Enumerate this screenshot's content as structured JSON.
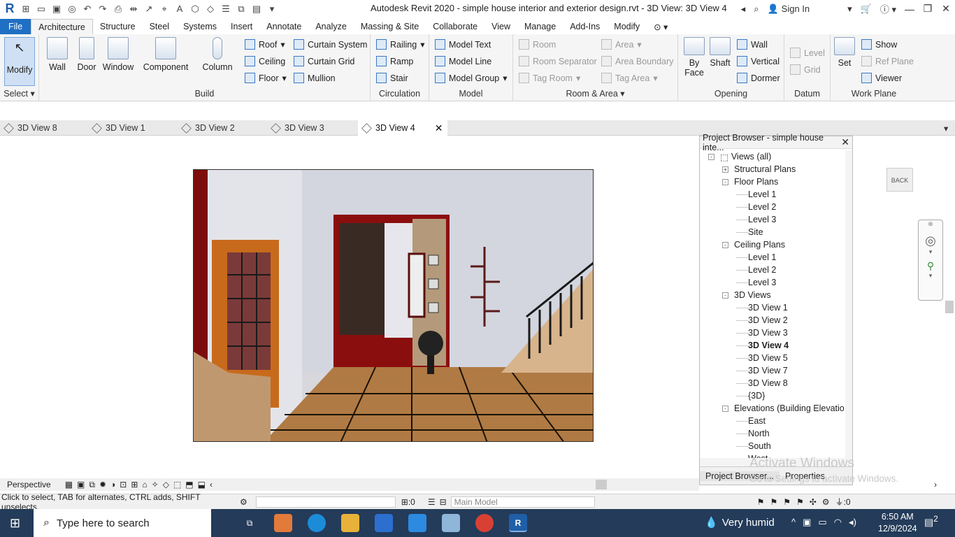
{
  "app": {
    "title": "Autodesk Revit 2020 - simple house interior and exterior design.rvt - 3D View: 3D View 4",
    "sign_in": "Sign In"
  },
  "ribbon_tabs": [
    "File",
    "Architecture",
    "Structure",
    "Steel",
    "Systems",
    "Insert",
    "Annotate",
    "Analyze",
    "Massing & Site",
    "Collaborate",
    "View",
    "Manage",
    "Add-Ins",
    "Modify"
  ],
  "ribbon": {
    "select": {
      "modify": "Modify",
      "label": "Select"
    },
    "build": {
      "wall": "Wall",
      "door": "Door",
      "window": "Window",
      "component": "Component",
      "column": "Column",
      "roof": "Roof",
      "ceiling": "Ceiling",
      "floor": "Floor",
      "curtain_system": "Curtain System",
      "curtain_grid": "Curtain Grid",
      "mullion": "Mullion",
      "label": "Build"
    },
    "circulation": {
      "railing": "Railing",
      "ramp": "Ramp",
      "stair": "Stair",
      "label": "Circulation"
    },
    "model": {
      "model_text": "Model Text",
      "model_line": "Model Line",
      "model_group": "Model Group",
      "label": "Model"
    },
    "room_area": {
      "room": "Room",
      "room_separator": "Room Separator",
      "tag_room": "Tag Room",
      "area": "Area",
      "area_boundary": "Area Boundary",
      "tag_area": "Tag Area",
      "label": "Room & Area"
    },
    "opening": {
      "by_face": "By\nFace",
      "shaft": "Shaft",
      "wall": "Wall",
      "vertical": "Vertical",
      "dormer": "Dormer",
      "label": "Opening"
    },
    "datum": {
      "level": "Level",
      "grid": "Grid",
      "label": "Datum"
    },
    "work_plane": {
      "set": "Set",
      "show": "Show",
      "ref_plane": "Ref Plane",
      "viewer": "Viewer",
      "label": "Work Plane"
    }
  },
  "view_tabs": [
    "3D View 8",
    "3D View 1",
    "3D View 2",
    "3D View 3",
    "3D View 4"
  ],
  "project_browser": {
    "title": "Project Browser - simple house inte...",
    "tree": [
      {
        "label": "Views (all)",
        "depth": 0,
        "toggle": "-"
      },
      {
        "label": "Structural Plans",
        "depth": 1,
        "toggle": "+"
      },
      {
        "label": "Floor Plans",
        "depth": 1,
        "toggle": "-"
      },
      {
        "label": "Level 1",
        "depth": 2
      },
      {
        "label": "Level 2",
        "depth": 2
      },
      {
        "label": "Level 3",
        "depth": 2
      },
      {
        "label": "Site",
        "depth": 2
      },
      {
        "label": "Ceiling Plans",
        "depth": 1,
        "toggle": "-"
      },
      {
        "label": "Level 1",
        "depth": 2
      },
      {
        "label": "Level 2",
        "depth": 2
      },
      {
        "label": "Level 3",
        "depth": 2
      },
      {
        "label": "3D Views",
        "depth": 1,
        "toggle": "-"
      },
      {
        "label": "3D View 1",
        "depth": 2
      },
      {
        "label": "3D View 2",
        "depth": 2
      },
      {
        "label": "3D View 3",
        "depth": 2
      },
      {
        "label": "3D View 4",
        "depth": 2,
        "selected": true
      },
      {
        "label": "3D View 5",
        "depth": 2
      },
      {
        "label": "3D View 7",
        "depth": 2
      },
      {
        "label": "3D View 8",
        "depth": 2
      },
      {
        "label": "{3D}",
        "depth": 2
      },
      {
        "label": "Elevations (Building Elevation",
        "depth": 1,
        "toggle": "-"
      },
      {
        "label": "East",
        "depth": 2
      },
      {
        "label": "North",
        "depth": 2
      },
      {
        "label": "South",
        "depth": 2
      },
      {
        "label": "West",
        "depth": 2
      }
    ],
    "tabs": [
      "Project Browser...",
      "Properties"
    ]
  },
  "viewcube_label": "BACK",
  "view_bar": {
    "mode": "Perspective"
  },
  "status": {
    "hint": "Click to select, TAB for alternates, CTRL adds, SHIFT unselects.",
    "count": ":0",
    "model": "Main Model",
    "filter": ":0"
  },
  "watermark": {
    "line1": "Activate Windows",
    "line2": "Go to Settings to activate Windows."
  },
  "taskbar": {
    "search": "Type here to search",
    "weather": "Very humid",
    "time": "6:50 AM",
    "date": "12/9/2024",
    "notif": "2"
  }
}
